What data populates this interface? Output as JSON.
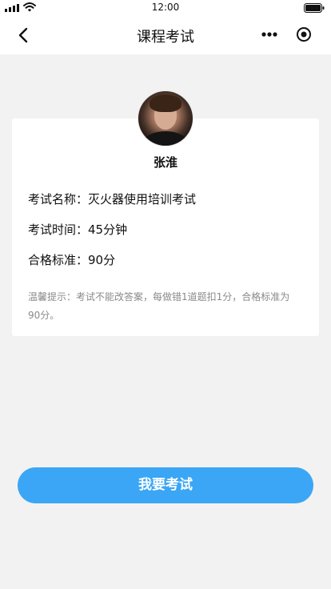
{
  "status_bar": {
    "time": "12:00"
  },
  "nav": {
    "title": "课程考试"
  },
  "user": {
    "name": "张淮"
  },
  "exam": {
    "name_label": "考试名称：",
    "name_value": "灭火器使用培训考试",
    "time_label": "考试时间：",
    "time_value": "45分钟",
    "pass_label": "合格标准：",
    "pass_value": "90分",
    "tip": "温馨提示：考试不能改答案，每做错1道题扣1分，合格标准为90分。"
  },
  "actions": {
    "start_label": "我要考试"
  },
  "colors": {
    "primary": "#3ba6f5",
    "background": "#f2f2f2",
    "card": "#ffffff",
    "tip_text": "#8a8a8a"
  },
  "icons": {
    "back": "chevron-left-icon",
    "more": "more-dots-icon",
    "close": "target-icon",
    "signal": "signal-icon",
    "wifi": "wifi-icon",
    "battery": "battery-icon"
  }
}
